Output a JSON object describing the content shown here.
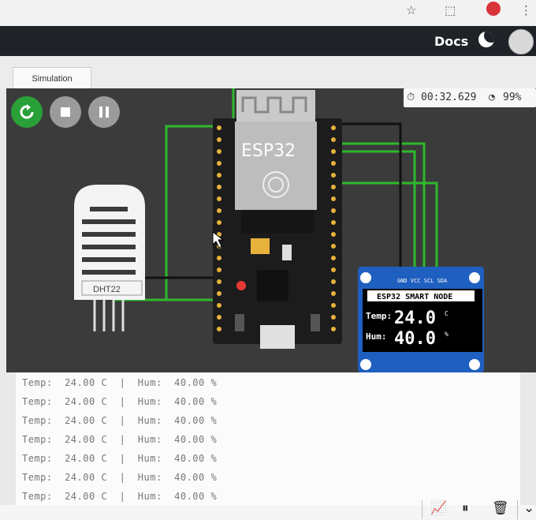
{
  "navbar": {
    "docs_label": "Docs"
  },
  "tabs": [
    {
      "label": "Simulation"
    }
  ],
  "controls": {
    "restart_icon": "restart-icon",
    "stop_icon": "stop-icon",
    "pause_icon": "pause-icon"
  },
  "status": {
    "time": "00:32.629",
    "speed": "99%"
  },
  "board": {
    "esp32_label": "ESP32",
    "dht_label": "DHT22"
  },
  "oled": {
    "title": "ESP32 SMART NODE",
    "pins": "GND VCC SCL SDA",
    "temp_label": "Temp:",
    "temp_value": "24.0",
    "temp_unit": "C",
    "hum_label": "Hum:",
    "hum_value": "40.0",
    "hum_unit": "%"
  },
  "serial_monitor": {
    "lines": [
      "Temp:  24.00 C  |  Hum:  40.00 %",
      "Temp:  24.00 C  |  Hum:  40.00 %",
      "Temp:  24.00 C  |  Hum:  40.00 %",
      "Temp:  24.00 C  |  Hum:  40.00 %",
      "Temp:  24.00 C  |  Hum:  40.00 %",
      "Temp:  24.00 C  |  Hum:  40.00 %",
      "Temp:  24.00 C  |  Hum:  40.00 %"
    ]
  },
  "colors": {
    "wire_green": "#2fb82b",
    "run_green": "#2aa138",
    "board": "#1c1c1c",
    "oled_frame": "#1f5fbf"
  }
}
